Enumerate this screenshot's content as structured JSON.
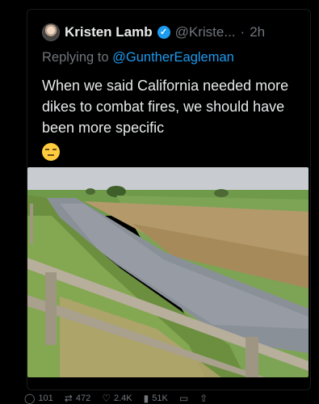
{
  "post": {
    "author_name": "Kristen Lamb",
    "handle": "@Kriste...",
    "separator": "·",
    "time": "2h",
    "replying_prefix": "Replying to ",
    "replying_to": "@GuntherEagleman",
    "text": "When we said California needed more dikes to combat fires, we should have been more specific",
    "emoji": "expressionless-face"
  },
  "image": {
    "subject": "drainage-ditch-with-wooden-fence"
  },
  "actions": {
    "replies": "101",
    "reposts": "472",
    "likes": "2.4K",
    "views": "51K"
  },
  "colors": {
    "background": "#000000",
    "text_primary": "#e7e9ea",
    "text_secondary": "#71767b",
    "accent": "#1d9bf0"
  }
}
